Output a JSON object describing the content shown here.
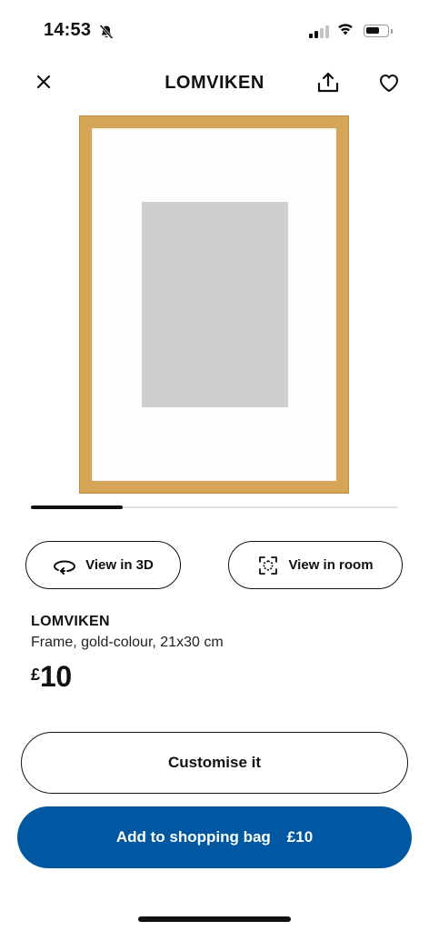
{
  "status_bar": {
    "time": "14:53",
    "icons": [
      "bell-slash-icon",
      "cellular-signal-icon",
      "wifi-icon",
      "battery-icon"
    ]
  },
  "header": {
    "title": "LOMVIKEN",
    "icons": [
      "close-icon",
      "share-icon",
      "heart-icon"
    ]
  },
  "product_image": {
    "frame_color": "#d5a657",
    "carousel_progress": 0.25
  },
  "view_buttons": {
    "view_3d_label": "View in 3D",
    "view_room_label": "View in room"
  },
  "product": {
    "name": "LOMVIKEN",
    "description": "Frame, gold-colour, 21x30 cm",
    "price_currency": "£",
    "price_value": "10"
  },
  "actions": {
    "customise_label": "Customise it",
    "add_to_bag_label": "Add to shopping bag",
    "add_to_bag_price": "£10",
    "accent_color": "#0058a3"
  }
}
